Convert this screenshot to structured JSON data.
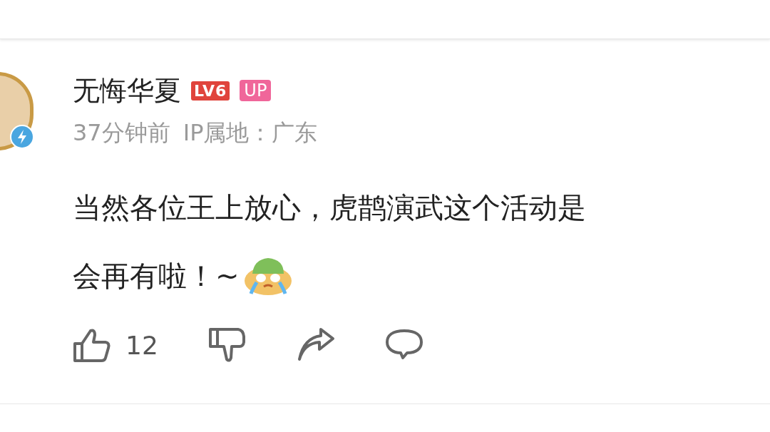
{
  "comment": {
    "author": "无悔华夏",
    "level_badge": "LV6",
    "up_badge": "UP",
    "time": "37分钟前",
    "ip_location": "IP属地：广东",
    "text_lines": [
      "当然各位王上放心，虎鹊演武这个活动是",
      "会再有啦！~"
    ],
    "likes": "12"
  }
}
